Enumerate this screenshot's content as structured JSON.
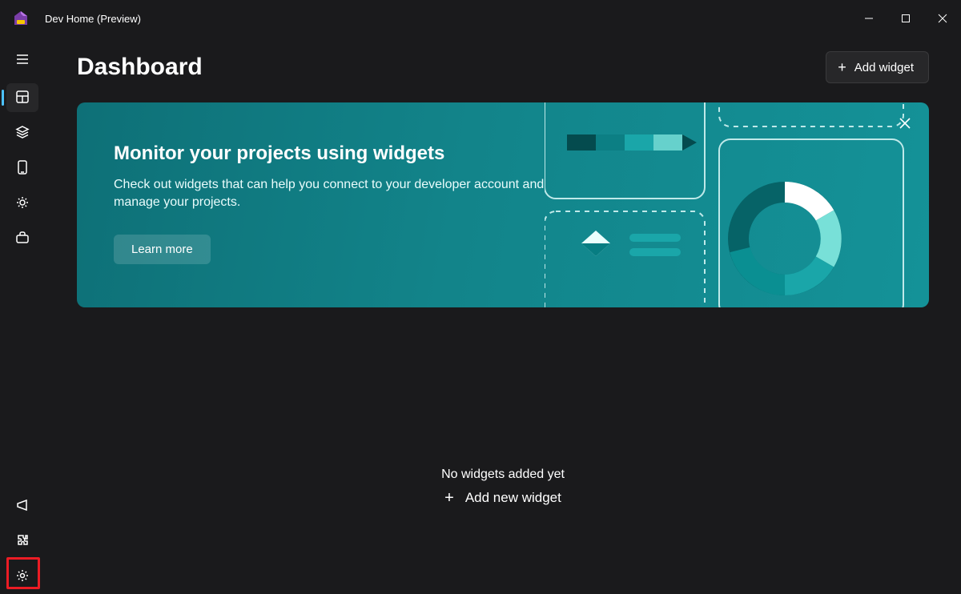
{
  "window": {
    "title": "Dev Home (Preview)"
  },
  "sidebar": {
    "hamburger": "menu",
    "items": [
      {
        "id": "dashboard",
        "icon": "dashboard-icon",
        "selected": true
      },
      {
        "id": "machineconf",
        "icon": "layers-icon",
        "selected": false
      },
      {
        "id": "device",
        "icon": "device-icon",
        "selected": false
      },
      {
        "id": "utilities",
        "icon": "gear-plus-icon",
        "selected": false
      },
      {
        "id": "toolbox",
        "icon": "briefcase-icon",
        "selected": false
      }
    ],
    "footer": [
      {
        "id": "feedback",
        "icon": "megaphone-icon"
      },
      {
        "id": "extensions",
        "icon": "puzzle-icon"
      },
      {
        "id": "settings",
        "icon": "settings-icon",
        "highlighted": true
      }
    ]
  },
  "header": {
    "page_title": "Dashboard",
    "add_widget_label": "Add widget"
  },
  "banner": {
    "heading": "Monitor your projects using widgets",
    "subheading": "Check out widgets that can help you connect to your developer account and manage your projects.",
    "learn_more_label": "Learn more"
  },
  "empty_state": {
    "line1": "No widgets added yet",
    "add_label": "Add new widget"
  },
  "colors": {
    "bg": "#1a1a1c",
    "banner_from": "#0e7077",
    "banner_to": "#149298",
    "accent": "#4cc2ff",
    "annotation": "#ec1c24"
  }
}
